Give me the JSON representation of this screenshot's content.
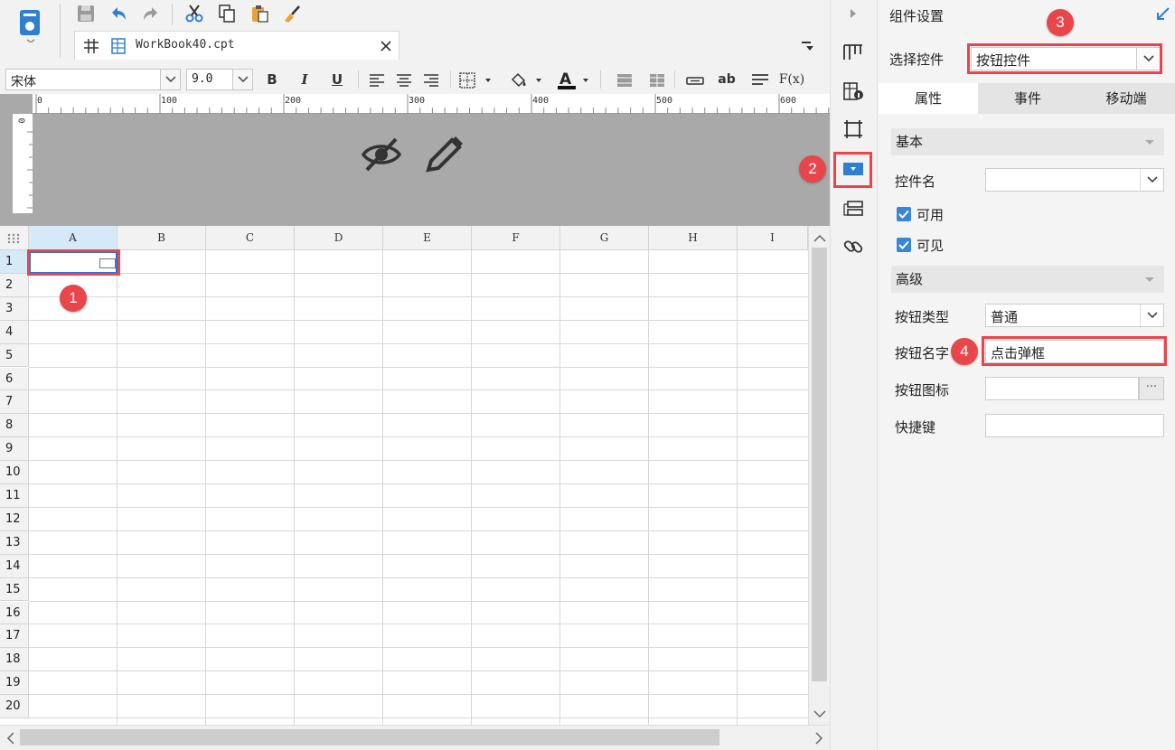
{
  "document": {
    "tab_label": "WorkBook40.cpt"
  },
  "format_toolbar": {
    "font_name": "宋体",
    "font_size": "9.0",
    "bold": "B",
    "italic": "I",
    "underline": "U",
    "wrap_text": "ab",
    "formula": "F(x)"
  },
  "ruler": {
    "ticks": [
      "0",
      "100",
      "200",
      "300",
      "400",
      "500",
      "600"
    ],
    "vertical_zero": "0"
  },
  "grid": {
    "columns": [
      "A",
      "B",
      "C",
      "D",
      "E",
      "F",
      "G",
      "H",
      "I"
    ],
    "rows": [
      "1",
      "2",
      "3",
      "4",
      "5",
      "6",
      "7",
      "8",
      "9",
      "10",
      "11",
      "12",
      "13",
      "14",
      "15",
      "16",
      "17",
      "18",
      "19",
      "20"
    ]
  },
  "panel": {
    "title": "组件设置",
    "select_control_label": "选择控件",
    "select_control_value": "按钮控件",
    "tabs": [
      "属性",
      "事件",
      "移动端"
    ],
    "basic_section": "基本",
    "control_name_label": "控件名",
    "control_name_value": "",
    "enabled_label": "可用",
    "visible_label": "可见",
    "advanced_section": "高级",
    "button_type_label": "按钮类型",
    "button_type_value": "普通",
    "button_name_label": "按钮名字",
    "button_name_value": "点击弹框",
    "button_icon_label": "按钮图标",
    "button_icon_more": "···",
    "shortcut_label": "快捷键"
  },
  "annotations": {
    "badge_1": "1",
    "badge_2": "2",
    "badge_3": "3",
    "badge_4": "4"
  },
  "colors": {
    "accent": "#3a86d6",
    "highlight": "#e8464b",
    "selected_column": "#d6e9f8"
  }
}
